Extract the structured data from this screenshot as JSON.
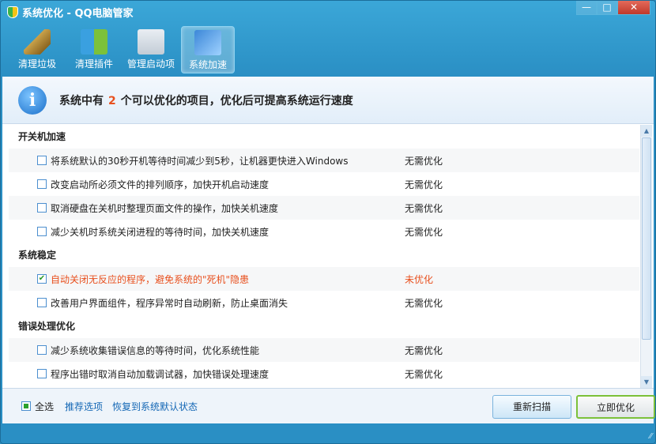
{
  "window": {
    "title": "系统优化 - QQ电脑管家",
    "controls": {
      "minimize": "—",
      "maximize": "□",
      "close": "✕"
    }
  },
  "toolbar": [
    {
      "label": "清理垃圾",
      "icon": "broom-icon"
    },
    {
      "label": "清理插件",
      "icon": "puzzle-icon"
    },
    {
      "label": "管理启动项",
      "icon": "startup-window-icon"
    },
    {
      "label": "系统加速",
      "icon": "monitor-speedup-icon",
      "active": true
    }
  ],
  "banner": {
    "prefix": "系统中有",
    "count": "2",
    "suffix": "个可以优化的项目，优化后可提高系统运行速度"
  },
  "sections": [
    {
      "title": "开关机加速",
      "items": [
        {
          "text": "将系统默认的30秒开机等待时间减少到5秒，让机器更快进入Windows",
          "status": "无需优化",
          "checked": false
        },
        {
          "text": "改变启动所必须文件的排列顺序，加快开机启动速度",
          "status": "无需优化",
          "checked": false
        },
        {
          "text": "取消硬盘在关机时整理页面文件的操作，加快关机速度",
          "status": "无需优化",
          "checked": false
        },
        {
          "text": "减少关机时系统关闭进程的等待时间，加快关机速度",
          "status": "无需优化",
          "checked": false
        }
      ]
    },
    {
      "title": "系统稳定",
      "items": [
        {
          "text": "自动关闭无反应的程序，避免系统的\"死机\"隐患",
          "status": "未优化",
          "checked": true
        },
        {
          "text": "改善用户界面组件，程序异常时自动刷新，防止桌面消失",
          "status": "无需优化",
          "checked": false
        }
      ]
    },
    {
      "title": "错误处理优化",
      "items": [
        {
          "text": "减少系统收集错误信息的等待时间，优化系统性能",
          "status": "无需优化",
          "checked": false
        },
        {
          "text": "程序出错时取消自动加载调试器，加快错误处理速度",
          "status": "无需优化",
          "checked": false
        }
      ]
    }
  ],
  "footer": {
    "select_all": "全选",
    "recommended": "推荐选项",
    "restore": "恢复到系统默认状态",
    "rescan": "重新扫描",
    "optimize": "立即优化"
  },
  "colors": {
    "accent": "#2a8fc4",
    "warning": "#e8501e"
  }
}
